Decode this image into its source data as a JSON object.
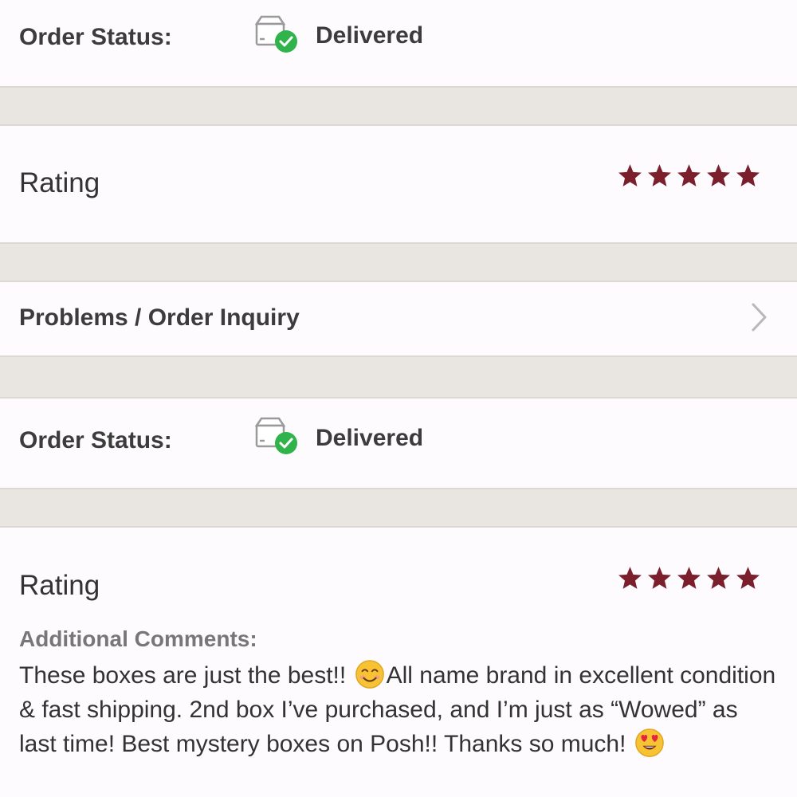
{
  "sections": [
    {
      "order_status_label": "Order Status:",
      "status_icon": "box-check-icon",
      "status_value": "Delivered"
    },
    {
      "rating_label": "Rating",
      "rating_stars": 5,
      "star_icon": "star-icon"
    },
    {
      "problems_label": "Problems / Order Inquiry",
      "chevron_icon": "chevron-right-icon"
    },
    {
      "order_status_label": "Order Status:",
      "status_icon": "box-check-icon",
      "status_value": "Delivered"
    },
    {
      "rating_label": "Rating",
      "rating_stars": 5,
      "comments_title": "Additional Comments:",
      "comment_part1": "These boxes are just the best!! ",
      "comment_emoji1": "smiling-face-emoji",
      "comment_part2": "All name brand in excellent condition & fast shipping. 2nd box I’ve purchased, and I’m just as “Wowed” as last time! Best mystery boxes on Posh!! Thanks so much! ",
      "comment_emoji2": "heart-eyes-emoji"
    }
  ],
  "colors": {
    "star": "#7c1f2d",
    "check_green": "#2fb34a",
    "separator": "#e9e6e1",
    "row_bg": "#fdfbfd",
    "chevron": "#b8b8b8"
  }
}
